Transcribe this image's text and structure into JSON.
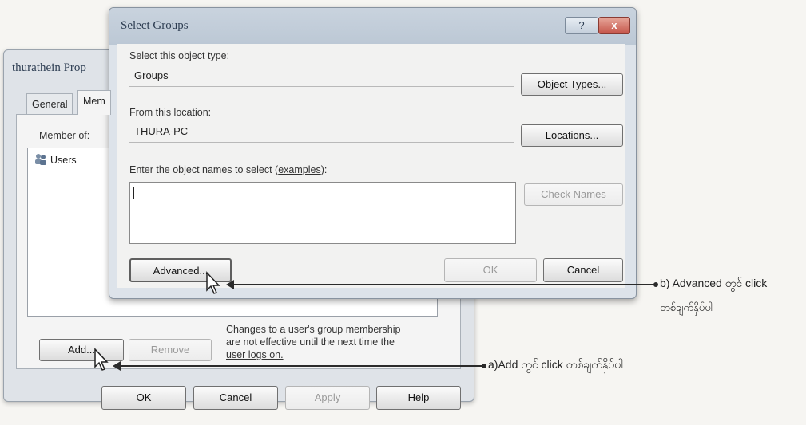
{
  "properties_window": {
    "title": "thurathein Prop",
    "tabs": [
      "General",
      "Mem"
    ],
    "member_of_label": "Member of:",
    "members": [
      "Users"
    ],
    "add_label": "Add...",
    "remove_label": "Remove",
    "note": [
      "Changes to a user's group membership",
      "are not effective until the next time the",
      "user logs on."
    ],
    "ok_label": "OK",
    "cancel_label": "Cancel",
    "apply_label": "Apply",
    "help_label": "Help"
  },
  "select_groups": {
    "title": "Select Groups",
    "help_glyph": "?",
    "close_glyph": "x",
    "object_type_label": "Select this object type:",
    "object_type_value": "Groups",
    "object_types_button": "Object Types...",
    "location_label": "From this location:",
    "location_value": "THURA-PC",
    "locations_button": "Locations...",
    "names_label_prefix": "Enter the object names to select (",
    "names_label_link": "examples",
    "names_label_suffix": "):",
    "check_names_button": "Check Names",
    "advanced_button": "Advanced...",
    "ok_button": "OK",
    "cancel_button": "Cancel"
  },
  "annotations": {
    "b": [
      "b) Advanced တွင် click",
      "တစ်ချက်နှိပ်ပါ"
    ],
    "a": "a)Add တွင် click တစ်ချက်နှိပ်ပါ"
  }
}
